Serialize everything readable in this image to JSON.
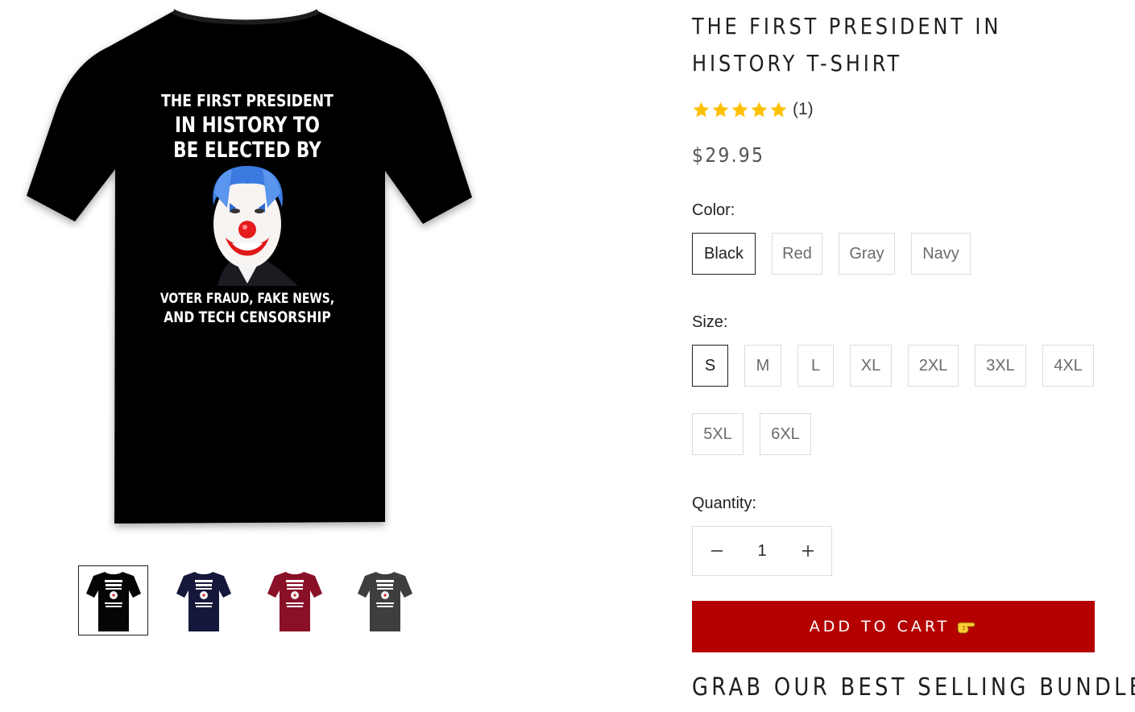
{
  "product": {
    "title": "The First President in History T-Shirt",
    "review_count": "(1)",
    "rating_stars": 5,
    "price": "$29.95"
  },
  "main_image": {
    "shirt_color": "#050505",
    "print_lines_top": [
      "THE FIRST PRESIDENT",
      "IN HISTORY TO",
      "BE ELECTED BY"
    ],
    "print_lines_bottom": [
      "VOTER FRAUD, FAKE NEWS,",
      "AND TECH CENSORSHIP"
    ]
  },
  "thumbnails": [
    {
      "color": "#050505",
      "active": true
    },
    {
      "color": "#15183a",
      "active": false
    },
    {
      "color": "#8a1028",
      "active": false
    },
    {
      "color": "#3e3e3e",
      "active": false
    }
  ],
  "color_option": {
    "label": "Color:",
    "values": [
      "Black",
      "Red",
      "Gray",
      "Navy"
    ],
    "selected": "Black"
  },
  "size_option": {
    "label": "Size:",
    "values": [
      "S",
      "M",
      "L",
      "XL",
      "2XL",
      "3XL",
      "4XL",
      "5XL",
      "6XL"
    ],
    "selected": "S"
  },
  "quantity": {
    "label": "Quantity:",
    "value": "1"
  },
  "cart": {
    "add_label": "ADD TO CART",
    "button_color": "#b50000"
  },
  "bundle": {
    "heading": "GRAB OUR BEST SELLING BUNDLE"
  },
  "colors": {
    "star": "#ffc107",
    "text": "#1e1e1e",
    "border": "#dcdcdc"
  },
  "icons": [
    "star-icon",
    "minus-icon",
    "plus-icon",
    "pointing-hand-icon",
    "clown-portrait-graphic"
  ]
}
